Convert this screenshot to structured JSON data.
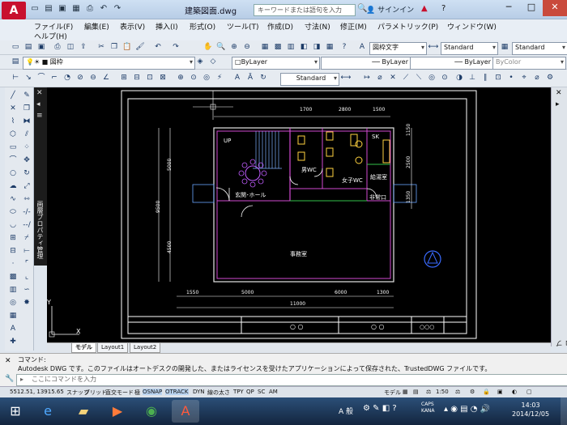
{
  "window": {
    "app_badge": "A",
    "title": "建築図面.dwg",
    "search_placeholder": "キーワードまたは語句を入力",
    "signin": "サインイン",
    "min": "─",
    "max": "□",
    "close": "✕"
  },
  "menu": [
    "ファイル(F)",
    "編集(E)",
    "表示(V)",
    "挿入(I)",
    "形式(O)",
    "ツール(T)",
    "作成(D)",
    "寸法(N)",
    "修正(M)",
    "パラメトリック(P)",
    "ウィンドウ(W)",
    "ヘルプ(H)"
  ],
  "toolbar": {
    "text_style": "図枠文字",
    "dim_style": "Standard",
    "table_style": "Standard",
    "layer": "図枠",
    "color": "ByLayer",
    "linetype": "ByLayer",
    "lineweight": "ByLayer",
    "plotstyle": "ByColor",
    "dimstyle2": "Standard"
  },
  "palettes": {
    "left_title": "画層プロパティ管理",
    "right_title": "プロパティ"
  },
  "drawing": {
    "dims_top": [
      "1700",
      "2800",
      "1500"
    ],
    "dims_bottom": [
      "1550",
      "5000",
      "6000",
      "1300"
    ],
    "dim_total": "11000",
    "dims_left": [
      "5000",
      "9500",
      "4500"
    ],
    "dims_right": [
      "1150",
      "2500",
      "1350"
    ],
    "rooms": {
      "up": "UP",
      "hall": "玄関･ホール",
      "office": "事務室",
      "men_wc": "男WC",
      "women_wc": "女子WC",
      "kitchen": "給湯室",
      "back_door": "非常口",
      "sk": "SK"
    },
    "ucs_y": "Y"
  },
  "tabs": [
    "モデル",
    "Layout1",
    "Layout2"
  ],
  "command": {
    "label": "コマンド:",
    "message": "Autodesk DWG です。このファイルはオートデスクの開発した、またはライセンスを受けたアプリケーションによって保存された、TrustedDWG ファイルです。",
    "placeholder": "ここにコマンドを入力"
  },
  "status": {
    "coords": "5512.51, 13915.65",
    "toggles": [
      "スナップ",
      "グリッド",
      "直交モード",
      "極",
      "OSNAP",
      "OTRACK",
      "DYN",
      "線の太さ",
      "TPY",
      "QP",
      "SC",
      "AM"
    ],
    "model": "モデル",
    "scale": "1:50"
  },
  "taskbar": {
    "ime": "A 般",
    "caps": "CAPS",
    "kana": "KANA",
    "time": "14:03",
    "date": "2014/12/05"
  },
  "colors": {
    "accent": "#c8102e",
    "canvas": "#000000"
  }
}
